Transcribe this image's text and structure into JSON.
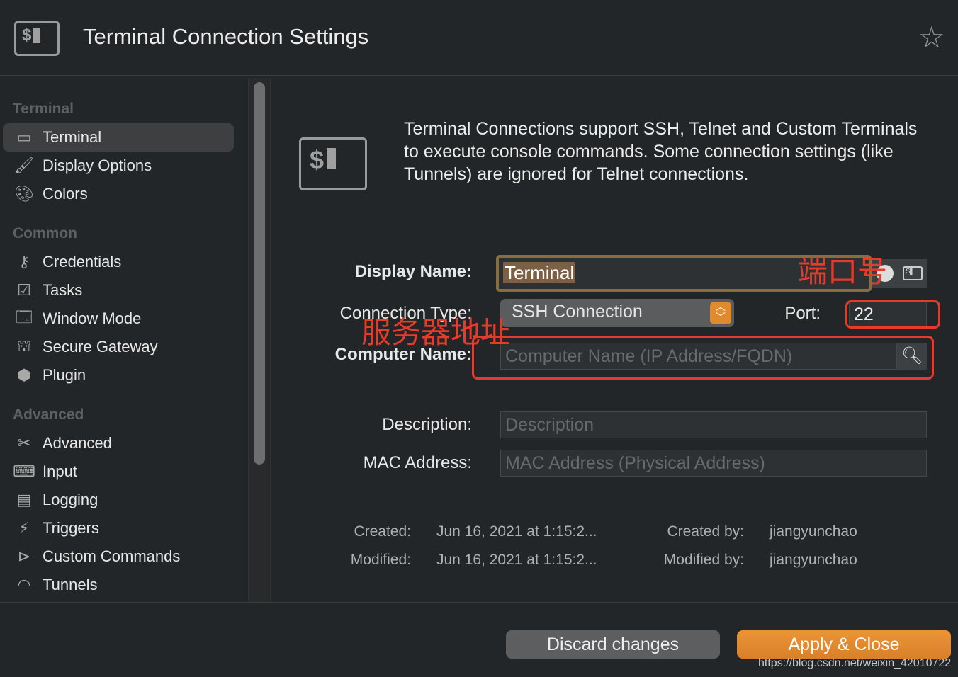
{
  "header": {
    "title": "Terminal Connection Settings",
    "icon": "terminal-icon",
    "favorite_icon": "star-icon"
  },
  "sidebar": {
    "sections": [
      {
        "title": "Terminal",
        "items": [
          {
            "label": "Terminal",
            "icon": "terminal-icon",
            "selected": true
          },
          {
            "label": "Display Options",
            "icon": "paintbrush-icon"
          },
          {
            "label": "Colors",
            "icon": "palette-icon"
          }
        ]
      },
      {
        "title": "Common",
        "items": [
          {
            "label": "Credentials",
            "icon": "key-icon"
          },
          {
            "label": "Tasks",
            "icon": "tasks-icon"
          },
          {
            "label": "Window Mode",
            "icon": "window-icon"
          },
          {
            "label": "Secure Gateway",
            "icon": "gateway-icon"
          },
          {
            "label": "Plugin",
            "icon": "cube-icon"
          }
        ]
      },
      {
        "title": "Advanced",
        "items": [
          {
            "label": "Advanced",
            "icon": "tools-icon"
          },
          {
            "label": "Input",
            "icon": "keyboard-icon"
          },
          {
            "label": "Logging",
            "icon": "log-icon"
          },
          {
            "label": "Triggers",
            "icon": "trigger-icon"
          },
          {
            "label": "Custom Commands",
            "icon": "console-icon"
          },
          {
            "label": "Tunnels",
            "icon": "tunnel-icon"
          }
        ]
      }
    ]
  },
  "main": {
    "intro": "Terminal Connections support SSH, Telnet and Custom Terminals to execute console commands. Some connection settings (like Tunnels) are ignored for Telnet connections.",
    "display_name_label": "Display Name:",
    "display_name_value": "Terminal",
    "connection_type_label": "Connection Type:",
    "connection_type_value": "SSH Connection",
    "port_label": "Port:",
    "port_value": "22",
    "computer_name_label": "Computer Name:",
    "computer_name_placeholder": "Computer Name (IP Address/FQDN)",
    "description_label": "Description:",
    "description_placeholder": "Description",
    "mac_label": "MAC Address:",
    "mac_placeholder": "MAC Address (Physical Address)",
    "created_label": "Created:",
    "created_value": "Jun 16, 2021 at 1:15:2...",
    "modified_label": "Modified:",
    "modified_value": "Jun 16, 2021 at 1:15:2...",
    "created_by_label": "Created by:",
    "created_by_value": "jiangyunchao",
    "modified_by_label": "Modified by:",
    "modified_by_value": "jiangyunchao"
  },
  "footer": {
    "discard": "Discard changes",
    "apply": "Apply & Close",
    "watermark": "https://blog.csdn.net/weixin_42010722"
  },
  "annotations": {
    "port": "端口号",
    "server": "服务器地址",
    "color": "#e63b2a"
  },
  "colors": {
    "accent": "#e88a2e",
    "background": "#232628"
  }
}
